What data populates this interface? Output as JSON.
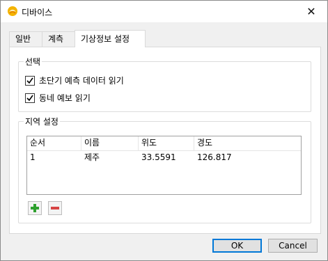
{
  "window": {
    "title": "디바이스",
    "close_glyph": "✕"
  },
  "tabs": [
    {
      "label": "일반"
    },
    {
      "label": "계측"
    },
    {
      "label": "기상정보 설정"
    }
  ],
  "selection_group": {
    "title": "선택",
    "options": [
      {
        "label": "초단기 예측 데이터 읽기",
        "checked": true
      },
      {
        "label": "동네 예보 읽기",
        "checked": true
      }
    ]
  },
  "region_group": {
    "title": "지역 설정",
    "columns": [
      "순서",
      "이름",
      "위도",
      "경도"
    ],
    "rows": [
      [
        "1",
        "제주",
        "33.5591",
        "126.817"
      ]
    ]
  },
  "buttons": {
    "ok": "OK",
    "cancel": "Cancel"
  },
  "colors": {
    "add_green": "#2ea02e",
    "remove_red": "#d64545",
    "default_border": "#0078d7"
  }
}
